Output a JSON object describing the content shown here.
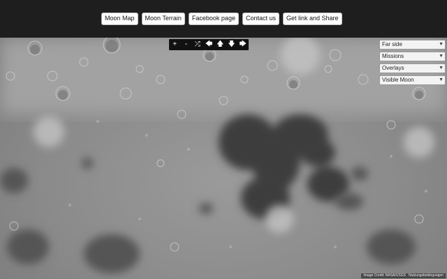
{
  "nav": {
    "items": [
      {
        "label": "Moon Map"
      },
      {
        "label": "Moon Terrain"
      },
      {
        "label": "Facebook page"
      },
      {
        "label": "Contact us"
      },
      {
        "label": "Get link and Share"
      }
    ]
  },
  "map_controls": {
    "zoom_in": "+",
    "zoom_out": "-",
    "random": "⤮",
    "pan_left": "🡄",
    "pan_up": "🡅",
    "pan_down": "🡇",
    "pan_right": "🡆"
  },
  "dropdowns": [
    {
      "selected": "Far side"
    },
    {
      "selected": "Missions"
    },
    {
      "selected": "Overlays"
    },
    {
      "selected": "Visible Moon"
    }
  ],
  "attribution": {
    "credit": "Image Credit: NASA/USGS",
    "terms": "Nutzungsbedingungen"
  },
  "colors": {
    "topbar": "#1e1e1e",
    "control_bar": "#111111",
    "highlands": "#8b8b8b",
    "maria": "#3c3c3c"
  }
}
